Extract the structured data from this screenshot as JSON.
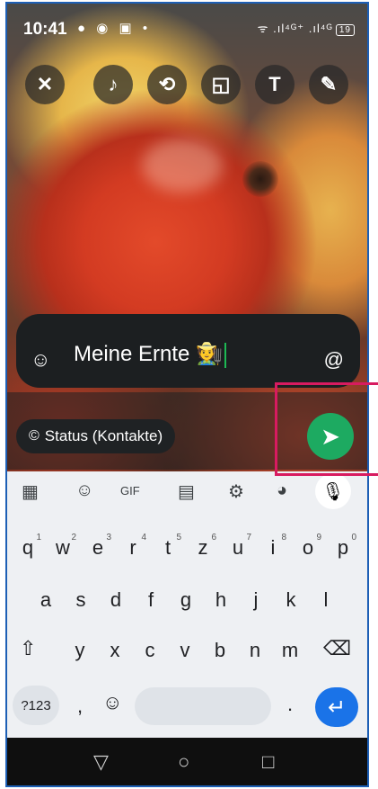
{
  "status_bar": {
    "time": "10:41",
    "left_icons": "● ◉ ▣ •",
    "right_icons": "ᯤ .ıl⁴ᴳ⁺ .ıl⁴ᴳ",
    "battery": "19"
  },
  "editor_tools": [
    {
      "name": "close-icon",
      "glyph": "✕"
    },
    {
      "name": "music-icon",
      "glyph": "♪"
    },
    {
      "name": "crop-rotate-icon",
      "glyph": "⟲"
    },
    {
      "name": "sticker-icon",
      "glyph": "◱"
    },
    {
      "name": "text-icon",
      "glyph": "T"
    },
    {
      "name": "pencil-icon",
      "glyph": "✎"
    }
  ],
  "caption": {
    "emoji_button": "☺",
    "text": "Meine Ernte 🧑‍🌾",
    "mention_button": "@"
  },
  "status_audience": {
    "icon": "©",
    "label": "Status (Kontakte)"
  },
  "send_button": {
    "glyph": "➤"
  },
  "keyboard": {
    "suggestion_icons": [
      "▦",
      "☺",
      "GIF",
      "▤",
      "⚙",
      "◕"
    ],
    "mic": "🎙",
    "row1": [
      {
        "k": "q",
        "n": "1"
      },
      {
        "k": "w",
        "n": "2"
      },
      {
        "k": "e",
        "n": "3"
      },
      {
        "k": "r",
        "n": "4"
      },
      {
        "k": "t",
        "n": "5"
      },
      {
        "k": "z",
        "n": "6"
      },
      {
        "k": "u",
        "n": "7"
      },
      {
        "k": "i",
        "n": "8"
      },
      {
        "k": "o",
        "n": "9"
      },
      {
        "k": "p",
        "n": "0"
      }
    ],
    "row2": [
      "a",
      "s",
      "d",
      "f",
      "g",
      "h",
      "j",
      "k",
      "l"
    ],
    "row3": [
      "y",
      "x",
      "c",
      "v",
      "b",
      "n",
      "m"
    ],
    "shift": "⇧",
    "backspace": "⌫",
    "num_key": "?123",
    "comma": ",",
    "emoji_key": "☺",
    "period": ".",
    "enter": "↵"
  },
  "navbar": {
    "back": "▽",
    "home": "○",
    "recents": "□"
  },
  "colors": {
    "send": "#1daa61",
    "highlight_box": "#d81b60",
    "enter_key": "#1a73e8"
  }
}
